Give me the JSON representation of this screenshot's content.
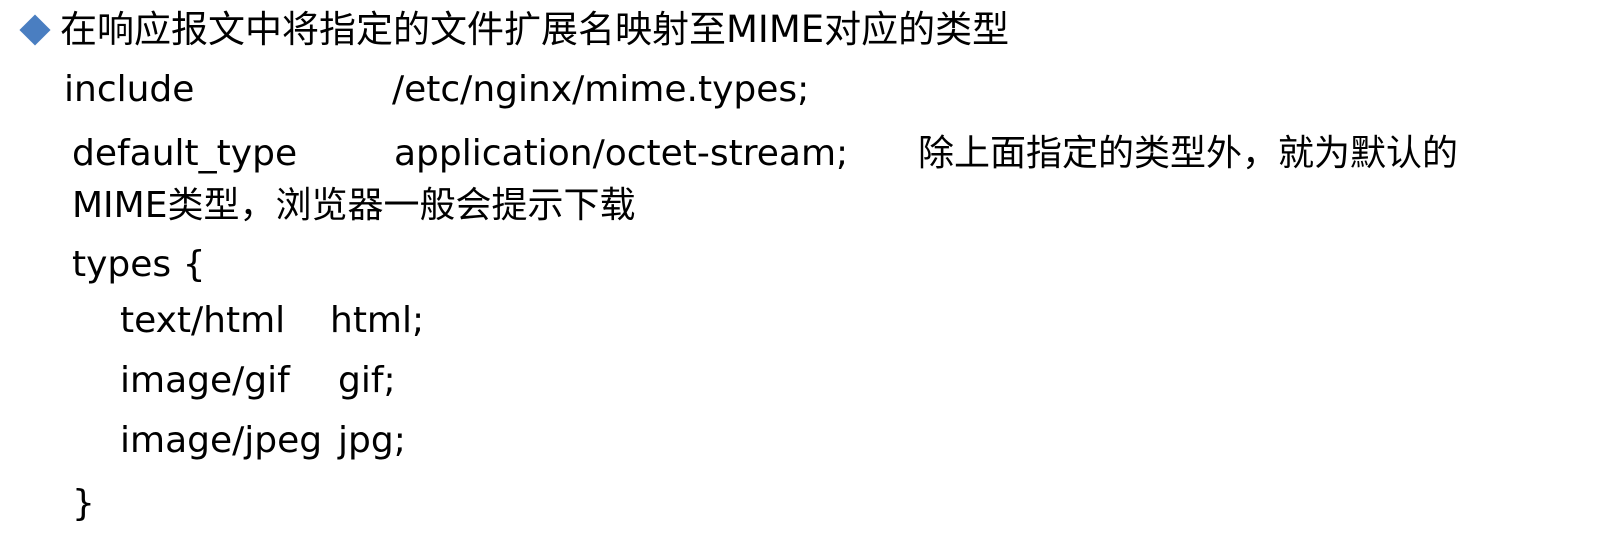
{
  "heading": {
    "text": "在响应报文中将指定的文件扩展名映射至MIME对应的类型"
  },
  "include": {
    "keyword": "include",
    "value": "/etc/nginx/mime.types;"
  },
  "default_type": {
    "keyword": "default_type",
    "value": "application/octet-stream;",
    "note_line1": "除上面指定的类型外，就为默认的",
    "note_line2": "MIME类型，浏览器一般会提示下载"
  },
  "types_block": {
    "open": "types {",
    "entries": [
      {
        "mime": "text/html",
        "ext": "html;"
      },
      {
        "mime": "image/gif",
        "ext": "gif;"
      },
      {
        "mime": "image/jpeg",
        "ext": "jpg;"
      }
    ],
    "close": "}"
  },
  "colors": {
    "bullet": "#4a7ec1",
    "text": "#000000",
    "background": "#ffffff"
  }
}
